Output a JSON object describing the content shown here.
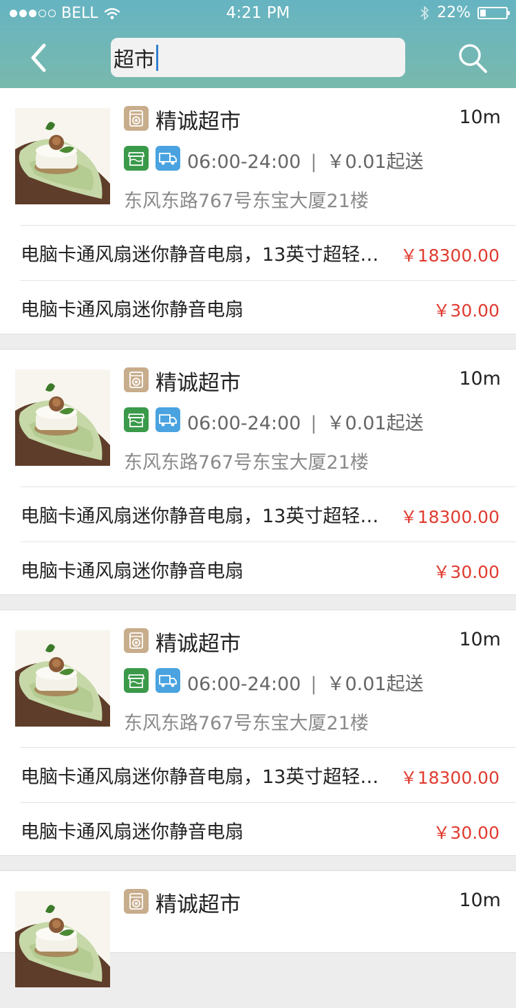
{
  "status_bar": {
    "carrier": "BELL",
    "time": "4:21 PM",
    "battery_percent_text": "22%",
    "battery_level": 0.22
  },
  "search": {
    "value": "超市"
  },
  "results": [
    {
      "store_name": "精诚超市",
      "distance": "10m",
      "hours": "06:00-24:00",
      "min_order": "￥0.01起送",
      "address": "东风东路767号东宝大厦21楼",
      "products": [
        {
          "name": "电脑卡通风扇迷你静音电扇，13英寸超轻…",
          "price": "￥18300.00"
        },
        {
          "name": "电脑卡通风扇迷你静音电扇",
          "price": "￥30.00"
        }
      ]
    },
    {
      "store_name": "精诚超市",
      "distance": "10m",
      "hours": "06:00-24:00",
      "min_order": "￥0.01起送",
      "address": "东风东路767号东宝大厦21楼",
      "products": [
        {
          "name": "电脑卡通风扇迷你静音电扇，13英寸超轻…",
          "price": "￥18300.00"
        },
        {
          "name": "电脑卡通风扇迷你静音电扇",
          "price": "￥30.00"
        }
      ]
    },
    {
      "store_name": "精诚超市",
      "distance": "10m",
      "hours": "06:00-24:00",
      "min_order": "￥0.01起送",
      "address": "东风东路767号东宝大厦21楼",
      "products": [
        {
          "name": "电脑卡通风扇迷你静音电扇，13英寸超轻…",
          "price": "￥18300.00"
        },
        {
          "name": "电脑卡通风扇迷你静音电扇",
          "price": "￥30.00"
        }
      ]
    },
    {
      "store_name": "精诚超市",
      "distance": "10m"
    }
  ],
  "colors": {
    "header_top": "#66b4c2",
    "header_bottom": "#79b9ad",
    "price": "#e03b2f",
    "store_icon": "#c8ad8c",
    "shop_badge": "#3a9a4a",
    "delivery_badge": "#4aa3e0"
  },
  "icons": {
    "back": "chevron-left-icon",
    "search": "search-icon",
    "store": "washer-icon",
    "shop": "storefront-icon",
    "delivery": "truck-icon"
  }
}
